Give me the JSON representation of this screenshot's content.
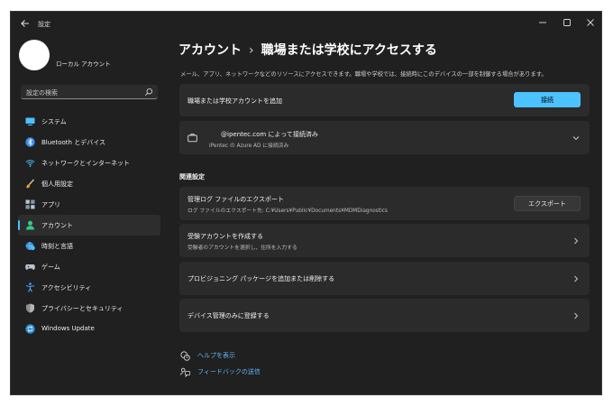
{
  "window": {
    "title": "設定"
  },
  "profile": {
    "name": "ローカル アカウント"
  },
  "search": {
    "placeholder": "設定の検索"
  },
  "sidebar": {
    "items": [
      {
        "label": "システム",
        "icon": "monitor-icon",
        "color": "#4cc2ff"
      },
      {
        "label": "Bluetooth とデバイス",
        "icon": "bluetooth-icon",
        "color": "#3b8eea"
      },
      {
        "label": "ネットワークとインターネット",
        "icon": "wifi-icon",
        "color": "#4cc2ff"
      },
      {
        "label": "個人用設定",
        "icon": "brush-icon",
        "color": "#f0a030"
      },
      {
        "label": "アプリ",
        "icon": "apps-icon",
        "color": "#b8c4d0"
      },
      {
        "label": "アカウント",
        "icon": "person-icon",
        "color": "#35c98b",
        "active": true
      },
      {
        "label": "時刻と言語",
        "icon": "globe-clock-icon",
        "color": "#4cc2ff"
      },
      {
        "label": "ゲーム",
        "icon": "gamepad-icon",
        "color": "#b8c4d0"
      },
      {
        "label": "アクセシビリティ",
        "icon": "accessibility-icon",
        "color": "#4ca0ff"
      },
      {
        "label": "プライバシーとセキュリティ",
        "icon": "shield-icon",
        "color": "#a8a8a8"
      },
      {
        "label": "Windows Update",
        "icon": "sync-icon",
        "color": "#4cc2ff"
      }
    ]
  },
  "header": {
    "breadcrumb_parent": "アカウント",
    "separator": "›",
    "title": "職場または学校にアクセスする",
    "description": "メール、アプリ、ネットワークなどのリソースにアクセスできます。職場や学校では、接続時にこのデバイスの一部を制御する場合があります。"
  },
  "add_account": {
    "label": "職場または学校アカウントを追加",
    "button": "接続"
  },
  "connected": {
    "title": "@ipentec.com によって接続済み",
    "subtitle": "iPentec の Azure AD に接続済み"
  },
  "related": {
    "title": "関連設定",
    "items": [
      {
        "title": "管理ログ ファイルのエクスポート",
        "subtitle": "ログ ファイルのエクスポート先: C:¥Users¥Public¥Documents¥MDMDiagnostics",
        "button": "エクスポート"
      },
      {
        "title": "受験アカウントを作成する",
        "subtitle": "受験者のアカウントを選択し、住所を入力する"
      },
      {
        "title": "プロビジョニング パッケージを追加または削除する"
      },
      {
        "title": "デバイス管理のみに登録する"
      }
    ]
  },
  "help": {
    "help_label": "ヘルプを表示",
    "feedback_label": "フィードバックの送信"
  },
  "colors": {
    "accent": "#4cc2ff",
    "background": "#202020",
    "card": "#2b2b2b",
    "link": "#5fb5f0"
  }
}
